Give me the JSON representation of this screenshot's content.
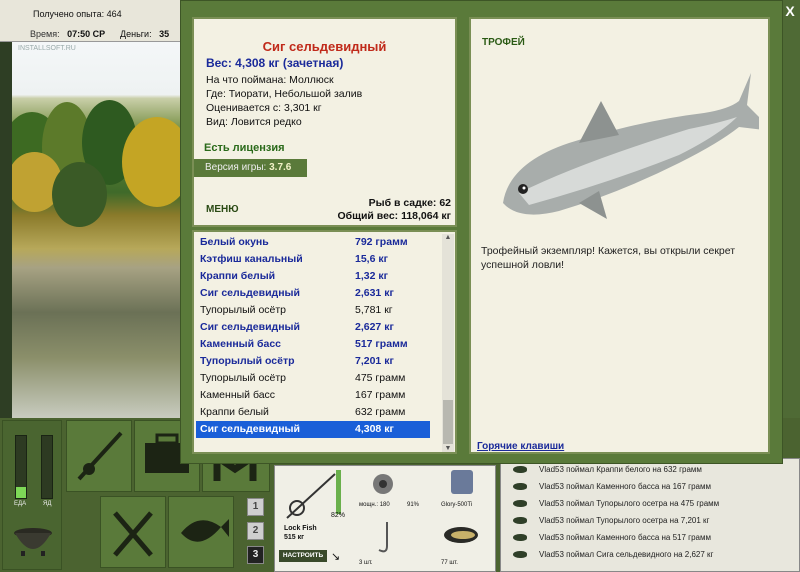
{
  "topbar": {
    "experience": "Получено опыта: 464",
    "time_label": "Время:",
    "time_value": "07:50 СР",
    "money_label": "Деньги:",
    "money_value": "35"
  },
  "scene": {
    "watermark": "INSTALLSOFT.RU"
  },
  "bottom": {
    "bar_food_label": "ЕДА",
    "bar_poison_label": "ЯД",
    "bar_food_level": 0.18,
    "bar_poison_level": 0.0,
    "numbers": [
      "1",
      "2",
      "3"
    ]
  },
  "tackle": {
    "rod_name": "Lock Fish",
    "rod_weight": "515 кг",
    "rod_percent": "82%",
    "setup_button": "НАСТРОИТЬ",
    "reel_info": "мощн.: 180",
    "reel_percent": "91%",
    "line_name": "Glory-500Ti",
    "hooks": "3 шт.",
    "bait": "77 шт."
  },
  "chat": [
    "Vlad53 поймал Краппи белого на 632 грамм",
    "Vlad53 поймал Каменного басса на 167 грамм",
    "Vlad53 поймал Тупорылого осетра на 475 грамм",
    "Vlad53 поймал Тупорылого осетра на 7,201 кг",
    "Vlad53 поймал Каменного басса на 517 грамм",
    "Vlad53 поймал Сига сельдевидного на 2,627 кг"
  ],
  "fish": {
    "name": "Сиг сельдевидный",
    "weight": "Вес: 4,308 кг (зачетная)",
    "bait": "На что поймана: Моллюск",
    "place": "Где: Тиорати, Небольшой залив",
    "valued": "Оценивается с: 3,301 кг",
    "kind": "Вид: Ловится редко"
  },
  "license": "Есть лицензия",
  "version_label": "Версия игры:",
  "version": "3.7.6",
  "menu": "МЕНЮ",
  "keepnet_count": "Рыб в садке: 62",
  "keepnet_weight": "Общий вес: 118,064 кг",
  "catches": [
    {
      "name": "Белый окунь",
      "weight": "792 грамм",
      "big": true
    },
    {
      "name": "Кэтфиш канальный",
      "weight": "15,6 кг",
      "big": true
    },
    {
      "name": "Краппи белый",
      "weight": "1,32 кг",
      "big": true
    },
    {
      "name": "Сиг сельдевидный",
      "weight": "2,631 кг",
      "big": true
    },
    {
      "name": "Тупорылый осётр",
      "weight": "5,781 кг",
      "big": false
    },
    {
      "name": "Сиг сельдевидный",
      "weight": "2,627 кг",
      "big": true
    },
    {
      "name": "Каменный басс",
      "weight": "517 грамм",
      "big": true
    },
    {
      "name": "Тупорылый осётр",
      "weight": "7,201 кг",
      "big": true
    },
    {
      "name": "Тупорылый осётр",
      "weight": "475 грамм",
      "big": false
    },
    {
      "name": "Каменный басс",
      "weight": "167 грамм",
      "big": false
    },
    {
      "name": "Краппи белый",
      "weight": "632 грамм",
      "big": false
    },
    {
      "name": "Сиг сельдевидный",
      "weight": "4,308 кг",
      "big": true,
      "selected": true
    }
  ],
  "trophy_title": "ТРОФЕЙ",
  "trophy_text": "Трофейный экземпляр! Кажется, вы открыли секрет успешной ловли!",
  "hotkeys": "Горячие клавиши",
  "close": "X"
}
